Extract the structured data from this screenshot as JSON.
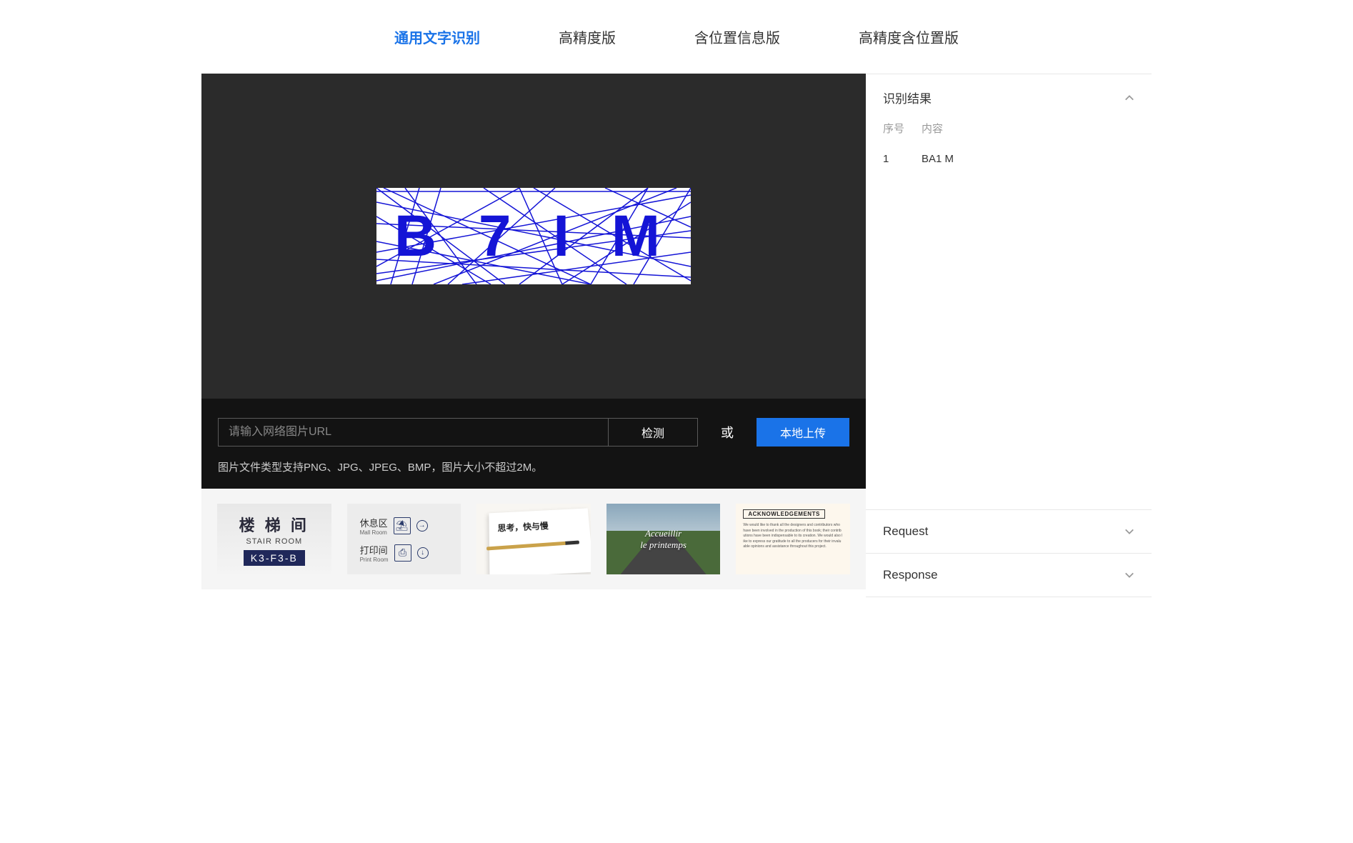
{
  "tabs": [
    {
      "label": "通用文字识别",
      "active": true
    },
    {
      "label": "高精度版",
      "active": false
    },
    {
      "label": "含位置信息版",
      "active": false
    },
    {
      "label": "高精度含位置版",
      "active": false
    }
  ],
  "captcha_text": "B 7 I M",
  "toolbar": {
    "url_placeholder": "请输入网络图片URL",
    "detect_label": "检测",
    "or_label": "或",
    "upload_label": "本地上传",
    "hint": "图片文件类型支持PNG、JPG、JPEG、BMP，图片大小不超过2M。"
  },
  "thumbnails": {
    "t1": {
      "cn": "楼 梯 间",
      "en": "STAIR ROOM",
      "bar": "K3-F3-B"
    },
    "t2": {
      "row1_cn": "休息区",
      "row1_en": "Mall Room",
      "row2_cn": "打印间",
      "row2_en": "Print Room"
    },
    "t3": {
      "title": "思考，快与慢"
    },
    "t4": {
      "line1": "Accueillir",
      "line2": "le printemps"
    },
    "t5": {
      "head": "ACKNOWLEDGEMENTS"
    }
  },
  "results": {
    "title": "识别结果",
    "col_index": "序号",
    "col_content": "内容",
    "rows": [
      {
        "index": "1",
        "content": "BA1 M"
      }
    ]
  },
  "request_title": "Request",
  "response_title": "Response"
}
